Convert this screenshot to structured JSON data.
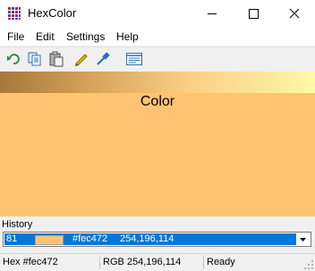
{
  "window": {
    "title": "HexColor",
    "controls": [
      "minimize",
      "maximize",
      "close"
    ]
  },
  "menu": {
    "items": [
      "File",
      "Edit",
      "Settings",
      "Help"
    ]
  },
  "toolbar": {
    "icons": [
      "undo-icon",
      "copy-icon",
      "paste-icon",
      "highlighter-icon",
      "eyedropper-icon",
      "details-icon"
    ]
  },
  "swatch": {
    "label": "Color",
    "color": "#fec472"
  },
  "history": {
    "label": "History",
    "selected": {
      "index": "81",
      "hex": "#fec472",
      "rgb": "254,196,114"
    }
  },
  "status": {
    "hex": "Hex #fec472",
    "rgb": "RGB 254,196,114",
    "state": "Ready"
  },
  "colors": {
    "accent": "#0078d7",
    "current": "#fec472"
  }
}
